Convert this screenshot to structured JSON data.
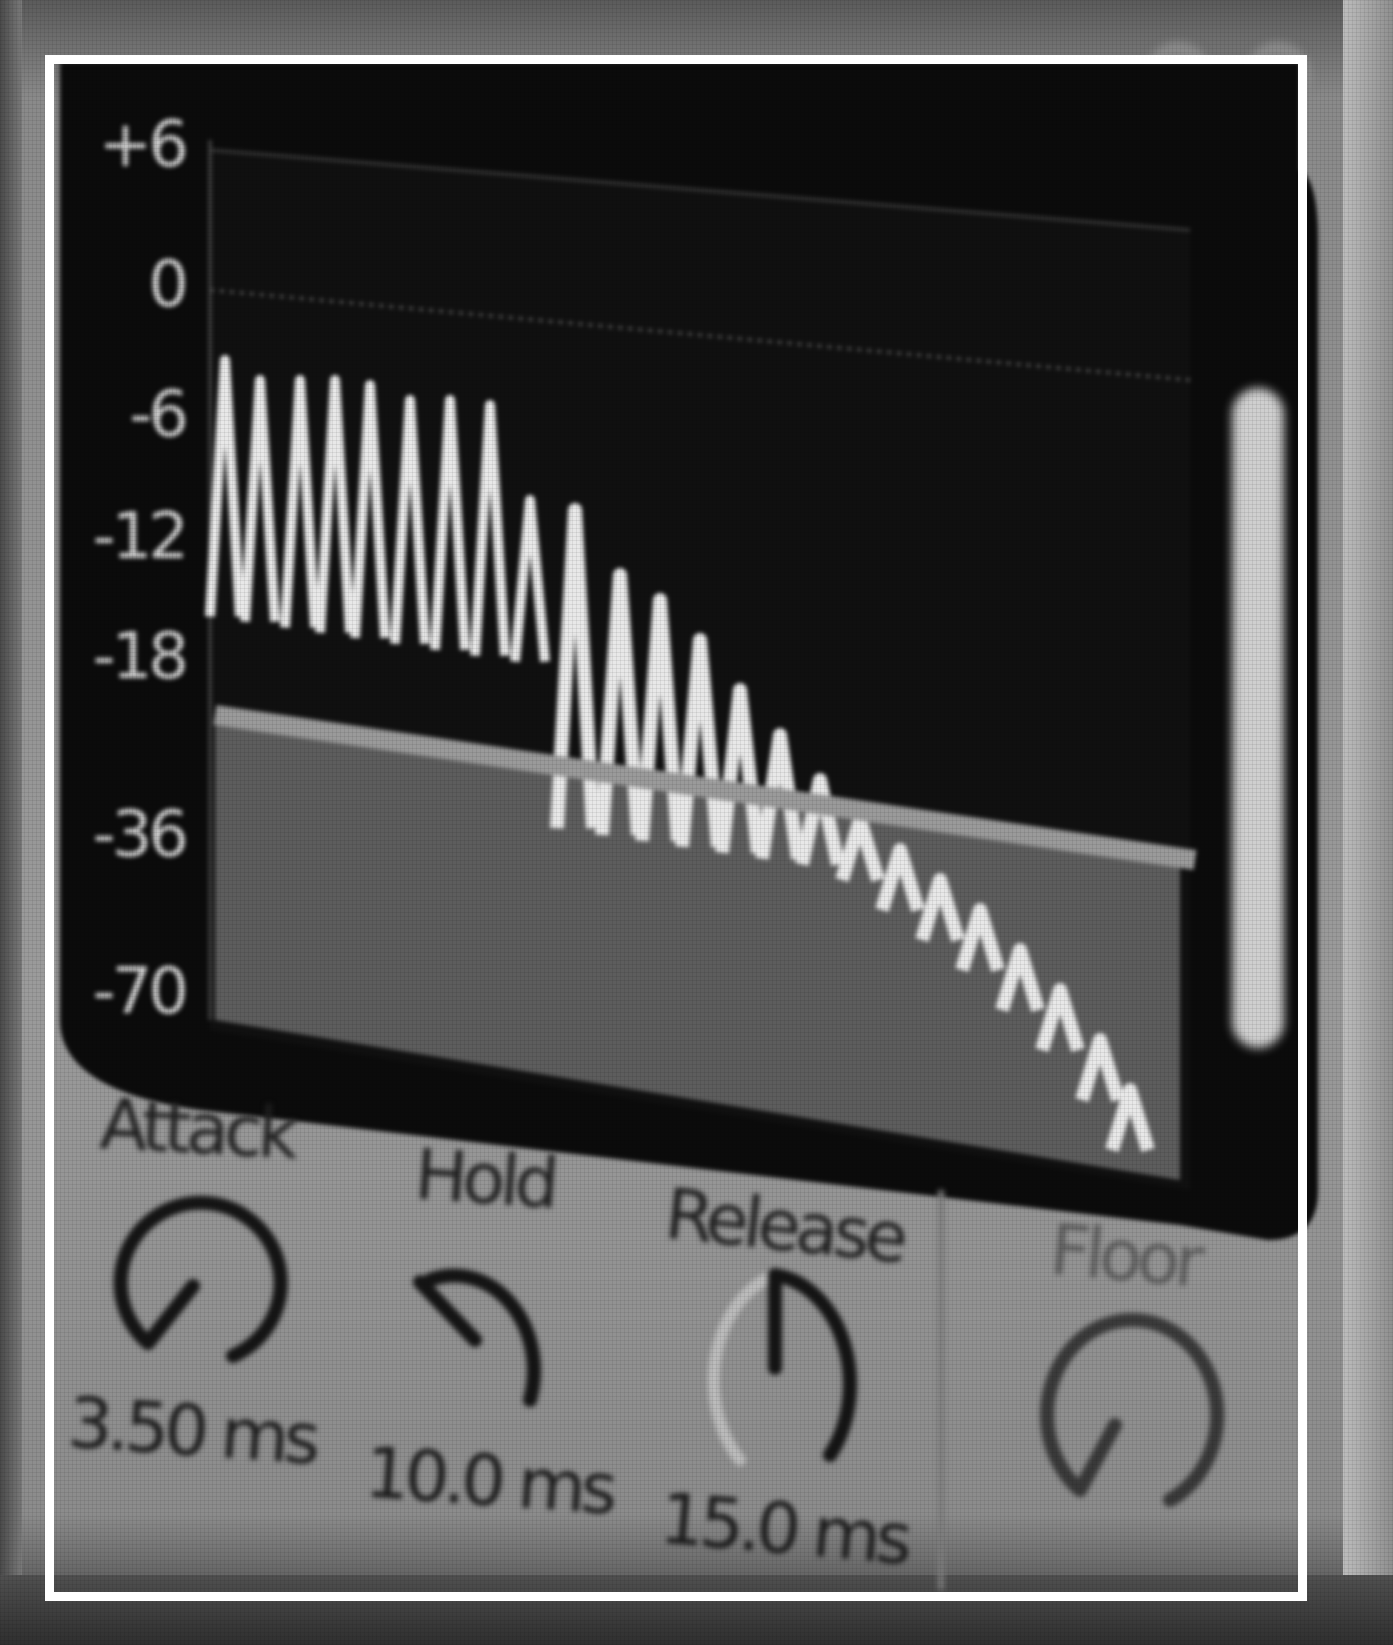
{
  "meter": {
    "db_scale": [
      "+6",
      "0",
      "-6",
      "-12",
      "-18",
      "-36",
      "-70"
    ]
  },
  "controls": {
    "attack": {
      "label": "Attack",
      "value": "3.50 ms"
    },
    "hold": {
      "label": "Hold",
      "value": "10.0 ms"
    },
    "release": {
      "label": "Release",
      "value": "15.0 ms"
    },
    "floor": {
      "label": "Floor",
      "value": ""
    }
  },
  "colors": {
    "display_bg": "#0b0b0b",
    "waveform": "#e8e8e8",
    "threshold_line": "#9a9a9a",
    "panel": "#9b9b9b",
    "knob_arc": "#141414"
  }
}
